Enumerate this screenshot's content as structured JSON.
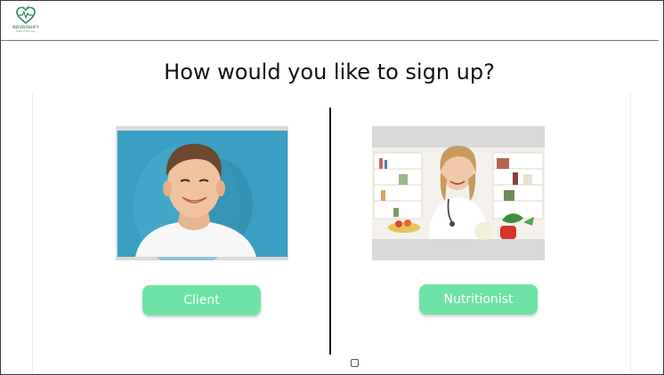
{
  "brand": {
    "name": "NOURISHIFY",
    "tagline": "health made easy",
    "accent_color": "#6ee3a6",
    "logo_icon": "heart-leaf-icon"
  },
  "page": {
    "title": "How would you like to sign up?"
  },
  "options": [
    {
      "label": "Client",
      "image": "client-photo"
    },
    {
      "label": "Nutritionist",
      "image": "nutritionist-photo"
    }
  ]
}
